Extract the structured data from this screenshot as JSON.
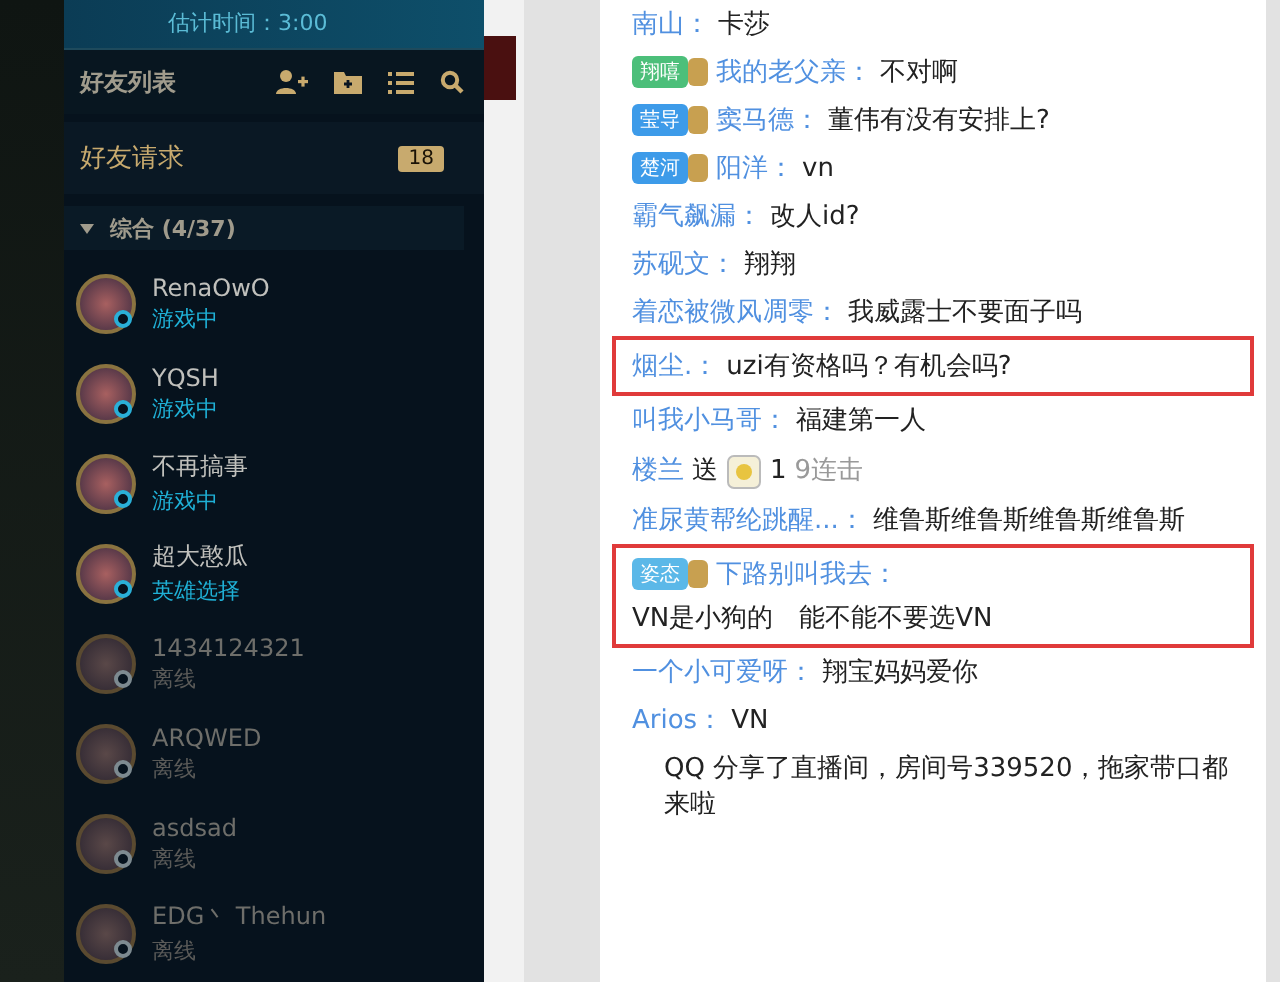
{
  "queue": {
    "estimate": "估计时间：3:00"
  },
  "friends_panel": {
    "title": "好友列表",
    "requests": {
      "label": "好友请求",
      "count": "18"
    },
    "group": {
      "label": "综合 (4/37)",
      "expanded": true
    },
    "friends": [
      {
        "name": "RenaOwO",
        "status": "游戏中",
        "online": true
      },
      {
        "name": "YQSH",
        "status": "游戏中",
        "online": true
      },
      {
        "name": "不再搞事",
        "status": "游戏中",
        "online": true
      },
      {
        "name": "超大憨瓜",
        "status": "英雄选择",
        "online": true
      },
      {
        "name": "1434124321",
        "status": "离线",
        "online": false
      },
      {
        "name": "ARQWED",
        "status": "离线",
        "online": false
      },
      {
        "name": "asdsad",
        "status": "离线",
        "online": false
      },
      {
        "name": "EDG丶 Thehun",
        "status": "离线",
        "online": false
      }
    ]
  },
  "chat": {
    "messages": [
      {
        "kind": "chat",
        "name": "南山：",
        "text": "卡莎",
        "highlighted": false
      },
      {
        "kind": "chat",
        "badge": {
          "text": "翔嘻",
          "color": "#4cbf7a"
        },
        "name": "我的老父亲：",
        "text": "不对啊",
        "highlighted": false
      },
      {
        "kind": "chat",
        "badge": {
          "text": "莹导",
          "color": "#3d9be9"
        },
        "name": "窦马德：",
        "text": "董伟有没有安排上?",
        "highlighted": false
      },
      {
        "kind": "chat",
        "badge": {
          "text": "楚河",
          "color": "#3d9be9"
        },
        "name": "阳洋：",
        "text": "vn",
        "highlighted": false
      },
      {
        "kind": "chat",
        "name": "霸气飙漏：",
        "text": "改人id?",
        "highlighted": false
      },
      {
        "kind": "chat",
        "name": "苏砚文：",
        "text": "翔翔",
        "highlighted": false
      },
      {
        "kind": "chat",
        "name": "着恋被微风凋零：",
        "text": "我威露士不要面子吗",
        "highlighted": false
      },
      {
        "kind": "chat",
        "name": "烟尘.：",
        "text": "uzi有资格吗？有机会吗?",
        "highlighted": true
      },
      {
        "kind": "chat",
        "name": "叫我小马哥：",
        "text": "福建第一人",
        "highlighted": false
      },
      {
        "kind": "gift",
        "name": "楼兰",
        "verb": "送",
        "count": "1",
        "combo": "9连击"
      },
      {
        "kind": "chat",
        "name": "准尿黄帮纶跳醒...：",
        "text": "维鲁斯维鲁斯维鲁斯维鲁斯",
        "highlighted": false
      },
      {
        "kind": "chat",
        "badge": {
          "text": "姿态",
          "color": "#5bb8e8"
        },
        "name": "下路别叫我去：",
        "text": "VN是小狗的　能不能不要选VN",
        "highlighted": true
      },
      {
        "kind": "chat",
        "name": "一个小可爱呀：",
        "text": "翔宝妈妈爱你",
        "highlighted": false
      },
      {
        "kind": "chat",
        "name": "Arios：",
        "text": "VN",
        "highlighted": false
      },
      {
        "kind": "share",
        "text": "QQ 分享了直播间，房间号339520，拖家带口都来啦"
      }
    ]
  }
}
